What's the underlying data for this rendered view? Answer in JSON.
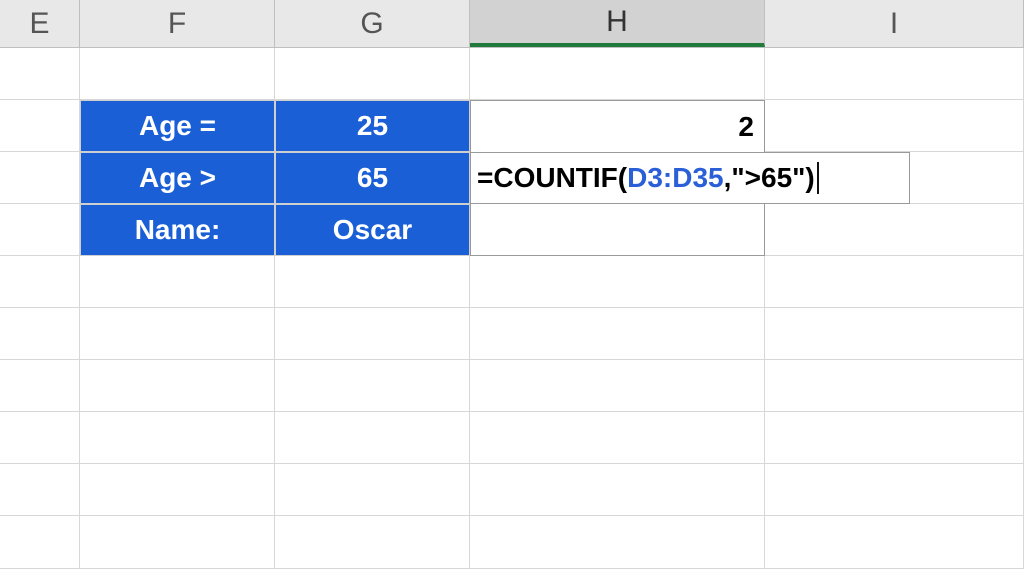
{
  "columns": {
    "E": "E",
    "F": "F",
    "G": "G",
    "H": "H",
    "I": "I"
  },
  "active_column": "H",
  "table": {
    "rows": [
      {
        "label": "Age =",
        "value": "25"
      },
      {
        "label": "Age >",
        "value": "65"
      },
      {
        "label": "Name:",
        "value": "Oscar"
      }
    ]
  },
  "results": {
    "H3": "2"
  },
  "formula": {
    "cell": "H4",
    "prefix": "=COUNTIF(",
    "ref": "D3:D35",
    "suffix": ",\">65\")"
  },
  "colors": {
    "blue_fill": "#1a5fd6"
  }
}
